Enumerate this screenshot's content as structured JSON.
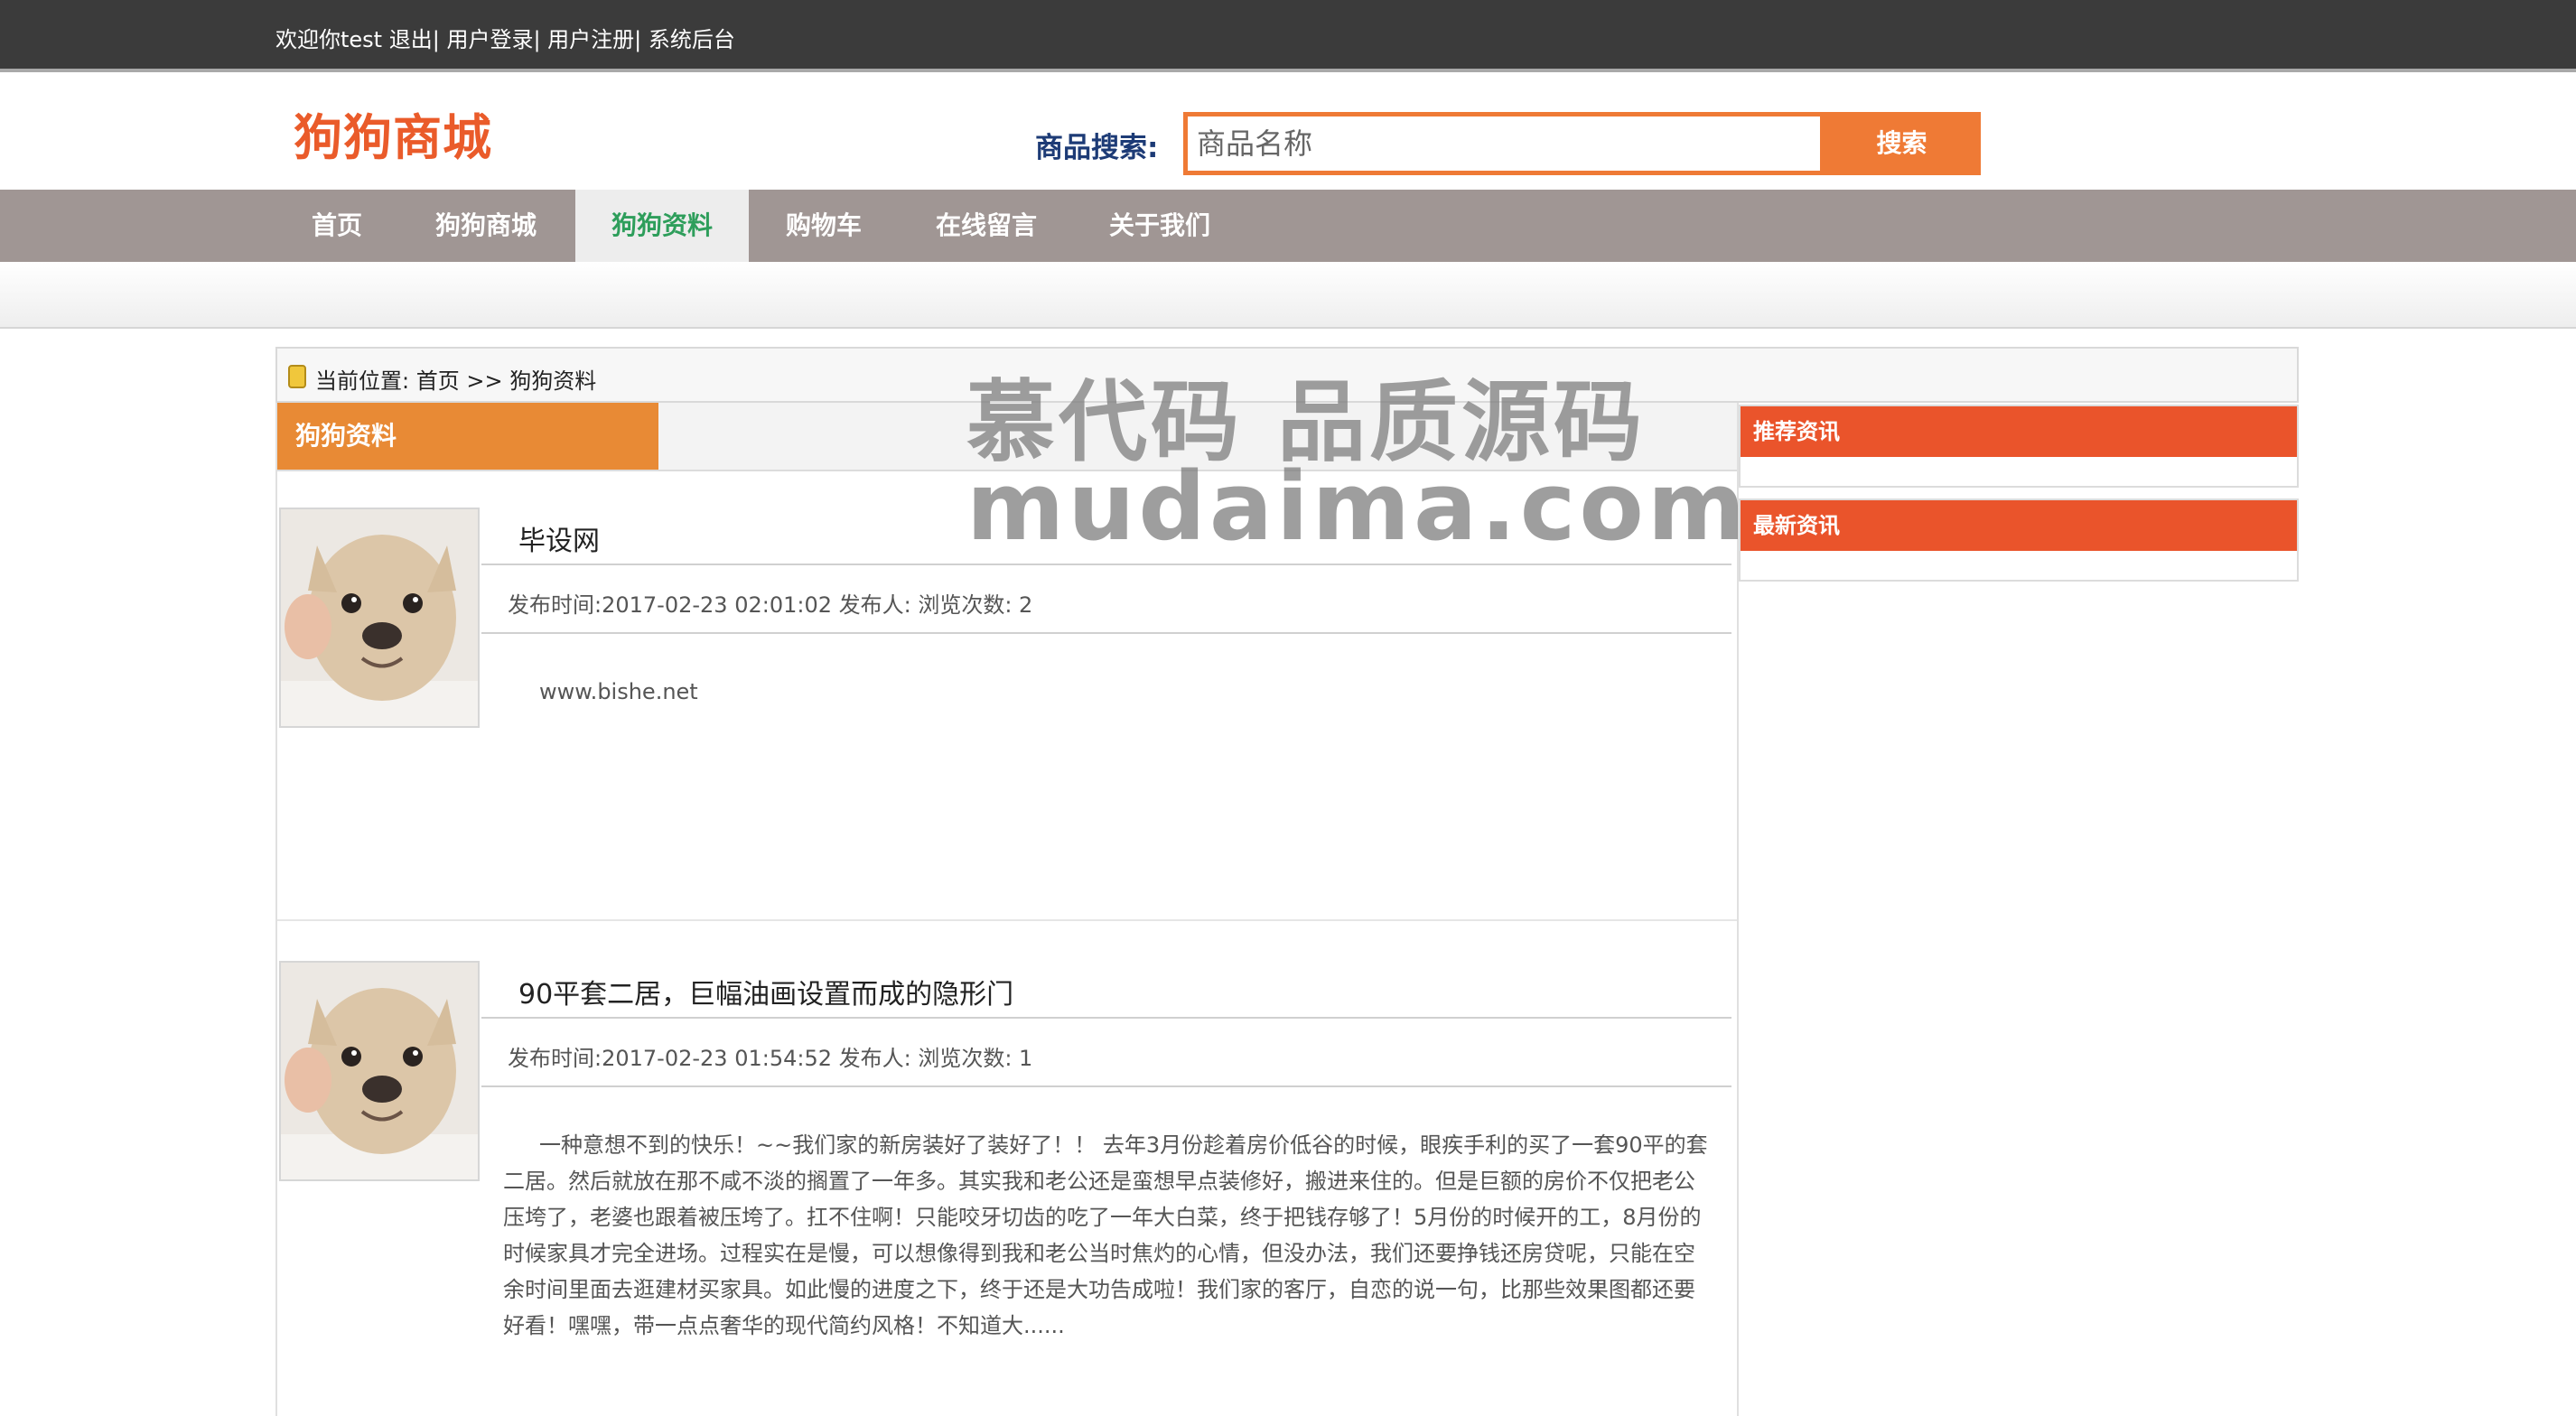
{
  "topbar": {
    "welcome": "欢迎你test",
    "logout": "退出",
    "login": "用户登录",
    "register": "用户注册",
    "admin": "系统后台"
  },
  "header": {
    "logo": "狗狗商城",
    "search_label": "商品搜索:",
    "search_placeholder": "商品名称",
    "search_button": "搜索"
  },
  "nav": {
    "items": [
      "首页",
      "狗狗商城",
      "狗狗资料",
      "购物车",
      "在线留言",
      "关于我们"
    ],
    "active_index": 2
  },
  "breadcrumb": {
    "text": "当前位置: 首页 >> 狗狗资料"
  },
  "section": {
    "title": "狗狗资料"
  },
  "articles": [
    {
      "title": "毕设网",
      "meta": "发布时间:2017-02-23 02:01:02 发布人: 浏览次数: 2",
      "body": "www.bishe.net"
    },
    {
      "title": "90平套二居，巨幅油画设置而成的隐形门",
      "meta": "发布时间:2017-02-23 01:54:52 发布人: 浏览次数: 1",
      "body": "一种意想不到的快乐！~~我们家的新房装好了装好了！！ 去年3月份趁着房价低谷的时候，眼疾手利的买了一套90平的套二居。然后就放在那不咸不淡的搁置了一年多。其实我和老公还是蛮想早点装修好，搬进来住的。但是巨额的房价不仅把老公压垮了，老婆也跟着被压垮了。扛不住啊！只能咬牙切齿的吃了一年大白菜，终于把钱存够了！5月份的时候开的工，8月份的时候家具才完全进场。过程实在是慢，可以想像得到我和老公当时焦灼的心情，但没办法，我们还要挣钱还房贷呢，只能在空余时间里面去逛建材买家具。如此慢的进度之下，终于还是大功告成啦！我们家的客厅，自恋的说一句，比那些效果图都还要好看！嘿嘿，带一点点奢华的现代简约风格！不知道大......"
    }
  ],
  "sidebar": {
    "recommended": "推荐资讯",
    "latest": "最新资讯"
  },
  "watermark": {
    "line1": "慕代码 品质源码",
    "line2": "mudaima.com"
  },
  "colors": {
    "accent_orange": "#ef7a35",
    "logo_red": "#ea5b2a",
    "nav_bg": "#a09694",
    "active_green": "#2e9e5b",
    "sidebar_head": "#ea542b",
    "section_tab": "#e88a35"
  }
}
